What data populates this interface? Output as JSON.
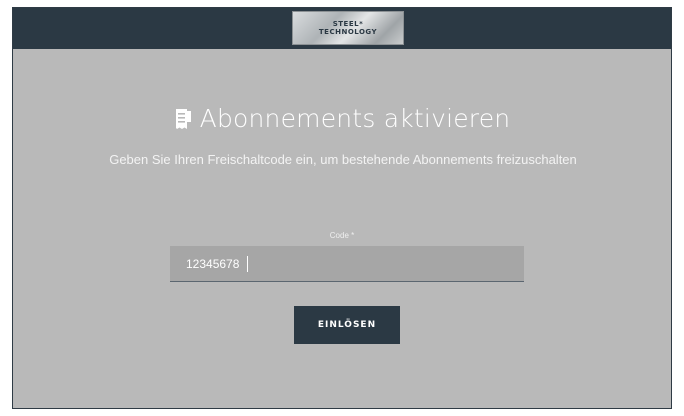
{
  "header": {
    "logo_text_line1": "STEEL*",
    "logo_text_line2": "TECHNOLOGY"
  },
  "main": {
    "title": "Abonnements aktivieren",
    "title_icon": "receipt-icon",
    "subtitle": "Geben Sie Ihren Freischaltcode ein, um bestehende Abonnements freizuschalten",
    "code_label": "Code *",
    "code_value": "12345678",
    "redeem_label": "EINLÖSEN"
  },
  "colors": {
    "header_bg": "#2b3944",
    "content_bg": "#b9b9b9",
    "input_bg": "#a6a6a6",
    "button_bg": "#2b3944",
    "text": "#ffffff"
  }
}
